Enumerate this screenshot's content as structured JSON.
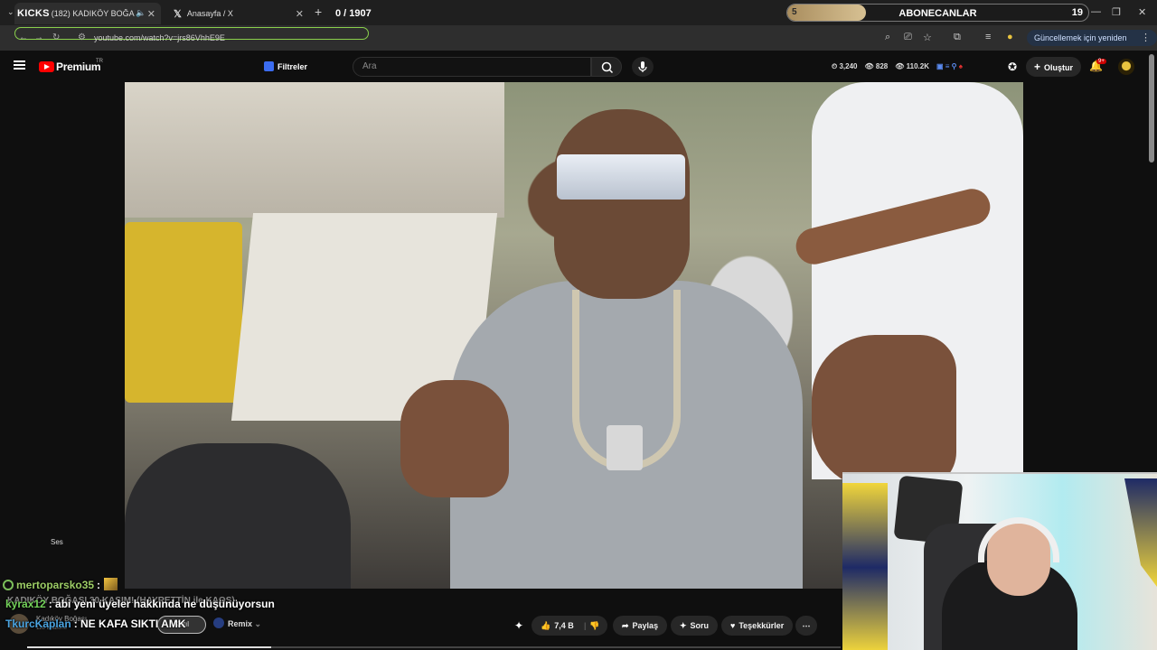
{
  "browser": {
    "tabs": [
      {
        "prefix": "KICKS",
        "label": "(182) KADIKÖY BOĞASI 30 ...",
        "active": true
      },
      {
        "label": "Anasayfa / X",
        "active": false
      }
    ],
    "tab_counter": "0 / 1907",
    "url": "youtube.com/watch?v=jrs86VhhE9E",
    "update_label": "Güncellemek için yeniden başlat"
  },
  "sub_goal": {
    "start": "5",
    "label": "ABONECANLAR",
    "end": "19",
    "progress": 0.26
  },
  "youtube": {
    "brand": "Premium",
    "country": "TR",
    "filters_label": "Filtreler",
    "search_placeholder": "Ara",
    "stats": [
      "3,240",
      "828",
      "110.2K"
    ],
    "create_label": "Oluştur",
    "notif_count": "9+"
  },
  "video": {
    "ses_label": "Ses",
    "title": "KADIKÖY BOĞASI 30 KASIM! (HAYRETTİN ile KAOS)",
    "channel_name": "Kadıköy Boğası",
    "channel_subs": "128 B abone",
    "join_label": "Katıl",
    "remix_label": "Remix",
    "like_count": "7,4 B",
    "share_label": "Paylaş",
    "ask_label": "Soru",
    "thanks_label": "Teşekkürler",
    "progress": 0.3
  },
  "chat": [
    {
      "user": "mertoparsko35",
      "message": "",
      "color": "#9ccc65"
    },
    {
      "user": "kyrax12",
      "message": ": abi yeni üyeler hakkında ne düşünüyorsun",
      "color": "#74d25a"
    },
    {
      "user": "TkurcKaplan",
      "message": ": NE KAFA SIKTI AMK",
      "color": "#4aa3df"
    }
  ]
}
